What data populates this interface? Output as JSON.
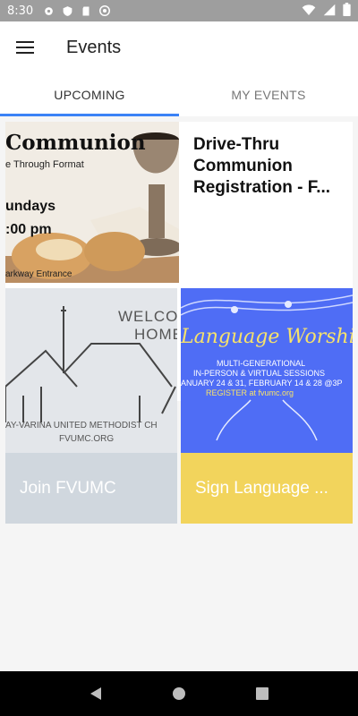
{
  "status_bar": {
    "time": "8:30"
  },
  "app_bar": {
    "title": "Events"
  },
  "tabs": [
    {
      "label": "UPCOMING",
      "active": true
    },
    {
      "label": "MY EVENTS",
      "active": false
    }
  ],
  "featured_event": {
    "title": "Drive-Thru Communion Registration - F...",
    "image_text": {
      "line1": "Communion",
      "line2": "e Through Format",
      "line3": "undays",
      "line4": ":00 pm",
      "line5": "arkway Entrance"
    }
  },
  "cards": [
    {
      "label": "Join FVUMC",
      "image_text": {
        "welcome": "WELCO",
        "home": "HOME",
        "church": "AY-VARINA UNITED METHODIST CH",
        "site": "FVUMC.ORG"
      }
    },
    {
      "label": "Sign Language ...",
      "image_text": {
        "heading": "Language Worship",
        "sub1": "MULTI-GENERATIONAL",
        "sub2": "IN-PERSON & VIRTUAL SESSIONS",
        "sub3": "ANUARY 24 & 31, FEBRUARY 14 & 28 @3P",
        "sub4": "REGISTER at fvumc.org"
      }
    }
  ],
  "colors": {
    "accent": "#3b82f6",
    "join_card": "#d0d7de",
    "sign_card": "#f2d45c",
    "sign_image_bg": "#4f6df5"
  }
}
